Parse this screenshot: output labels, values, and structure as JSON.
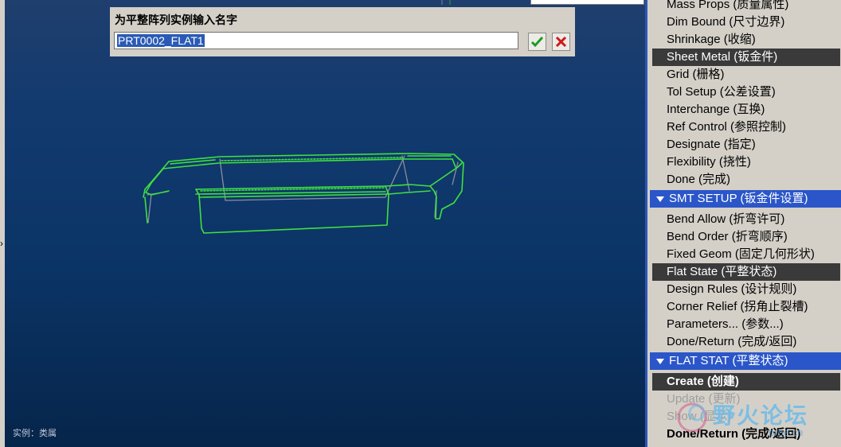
{
  "prompt": {
    "label": "为平整阵列实例输入名字",
    "value": "PRT0002_FLAT1"
  },
  "viewport": {
    "label": "实例：类属"
  },
  "menu": {
    "part_setup_items": [
      {
        "label": "Mass Props (质量属性)",
        "state": "normal"
      },
      {
        "label": "Dim Bound (尺寸边界)",
        "state": "normal"
      },
      {
        "label": "Shrinkage (收缩)",
        "state": "normal"
      },
      {
        "label": "Sheet Metal (钣金件)",
        "state": "selected"
      },
      {
        "label": "Grid (栅格)",
        "state": "normal"
      },
      {
        "label": "Tol Setup (公差设置)",
        "state": "normal"
      },
      {
        "label": "Interchange (互换)",
        "state": "normal"
      },
      {
        "label": "Ref Control (参照控制)",
        "state": "normal"
      },
      {
        "label": "Designate (指定)",
        "state": "normal"
      },
      {
        "label": "Flexibility (挠性)",
        "state": "normal"
      },
      {
        "label": "Done (完成)",
        "state": "normal"
      }
    ],
    "smt_setup": {
      "header": "SMT SETUP (钣金件设置)",
      "items": [
        {
          "label": "Bend Allow (折弯许可)",
          "state": "normal"
        },
        {
          "label": "Bend Order (折弯顺序)",
          "state": "normal"
        },
        {
          "label": "Fixed Geom (固定几何形状)",
          "state": "normal"
        },
        {
          "label": "Flat State (平整状态)",
          "state": "selected"
        },
        {
          "label": "Design Rules (设计规则)",
          "state": "normal"
        },
        {
          "label": "Corner Relief (拐角止裂槽)",
          "state": "normal"
        },
        {
          "label": "Parameters... (参数...)",
          "state": "normal"
        },
        {
          "label": "Done/Return (完成/返回)",
          "state": "normal"
        }
      ]
    },
    "flat_stat": {
      "header": "FLAT STAT (平整状态)",
      "items": [
        {
          "label": "Create (创建)",
          "state": "selected-bold"
        },
        {
          "label": "Update (更新)",
          "state": "disabled"
        },
        {
          "label": "Show (显示)",
          "state": "disabled"
        },
        {
          "label": "Done/Return (完成/返回)",
          "state": "bold"
        }
      ]
    }
  },
  "watermark": {
    "text": "野火论坛",
    "url": "proe.cn"
  },
  "colors": {
    "menu_header": "#2b56c9",
    "selected_row": "#3a3a3a",
    "model_edges": "#3fe040"
  }
}
